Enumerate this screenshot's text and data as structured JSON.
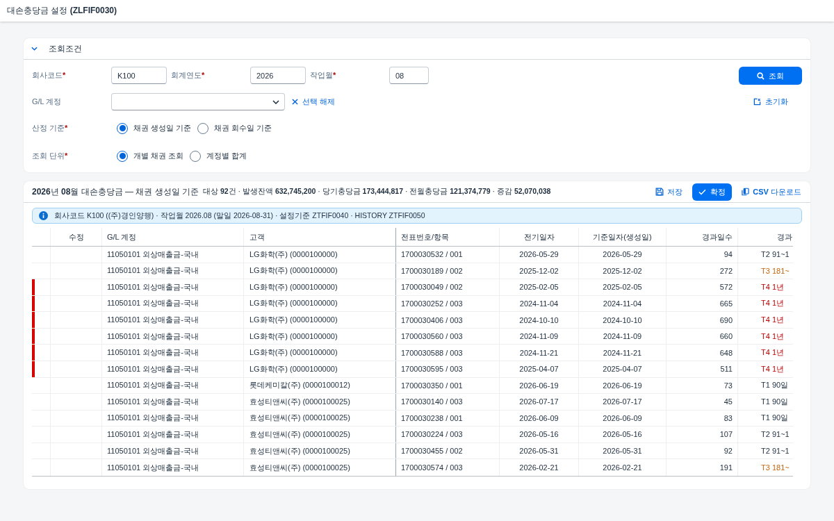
{
  "header": {
    "title": "대손충당금 설정 **(ZLFIF0030)**"
  },
  "filter_panel": {
    "title": "조회조건",
    "expanded": true,
    "fields": [
      {
        "label": "회사코드",
        "required_mark": "*",
        "value": "K100"
      },
      {
        "label": "회계연도",
        "required_mark": "*",
        "value": "2026"
      },
      {
        "label": "작업월",
        "required_mark": "*",
        "value": "08"
      }
    ],
    "gl_account": {
      "label": "G/L 계정",
      "clear_label": "선택 해제"
    },
    "radio_groups": [
      {
        "label": "산정 기준",
        "required_mark": "*",
        "options": [
          {
            "label": "채권 생성일 기준",
            "selected": true
          },
          {
            "label": "채권 회수일 기준",
            "selected": false
          }
        ]
      },
      {
        "label": "조회 단위",
        "required_mark": "*",
        "options": [
          {
            "label": "개별 채권 조회",
            "selected": true
          },
          {
            "label": "계정별 합계",
            "selected": false
          }
        ]
      }
    ],
    "search_button": "조회",
    "reset_link": "초기화"
  },
  "results": {
    "title": "**2026**년 **08**월 대손충당금 — 채권 생성일 기준",
    "summary": "대상 **92**건 · 발생잔액 **632,745,200** · 당기충당금 **173,444,817** · 전월충당금 **121,374,779** · 증감 **52,070,038**",
    "actions": [
      {
        "kind": "link",
        "label": "저장"
      },
      {
        "kind": "primary",
        "label": "확정"
      },
      {
        "kind": "link",
        "label": "**CSV** 다운로드"
      }
    ],
    "info": "회사코드 K100 ((주)경인양행) · 작업월 2026.08 (말일 2026-08-31) · 설정기준 ZTFIF0040 · HISTORY ZTFIF0050",
    "table": {
      "columns": [
        "수정",
        "G/L 계정",
        "고객",
        "전표번호/항목",
        "전기일자",
        "기준일자(생성일)",
        "경과일수",
        "경과"
      ],
      "rows": [
        {
          "flagged": false,
          "gl_account": "11050101 외상매출금-국내",
          "customer": "LG화학(주) (0000100000)",
          "document": "1700030532 / 001",
          "posting_date": "2026-05-29",
          "base_date": "2026-05-29",
          "elapsed_days": "94",
          "aging_bucket": "T2 91~1"
        },
        {
          "flagged": false,
          "gl_account": "11050101 외상매출금-국내",
          "customer": "LG화학(주) (0000100000)",
          "document": "1700030189 / 002",
          "posting_date": "2025-12-02",
          "base_date": "2025-12-02",
          "elapsed_days": "272",
          "aging_bucket": "T3 181~",
          "color": "#c5650c"
        },
        {
          "flagged": true,
          "gl_account": "11050101 외상매출금-국내",
          "customer": "LG화학(주) (0000100000)",
          "document": "1700030049 / 002",
          "posting_date": "2025-02-05",
          "base_date": "2025-02-05",
          "elapsed_days": "572",
          "aging_bucket": "T4 1년",
          "color": "#bb0000"
        },
        {
          "flagged": true,
          "gl_account": "11050101 외상매출금-국내",
          "customer": "LG화학(주) (0000100000)",
          "document": "1700030252 / 003",
          "posting_date": "2024-11-04",
          "base_date": "2024-11-04",
          "elapsed_days": "665",
          "aging_bucket": "T4 1년",
          "color": "#bb0000"
        },
        {
          "flagged": true,
          "gl_account": "11050101 외상매출금-국내",
          "customer": "LG화학(주) (0000100000)",
          "document": "1700030406 / 003",
          "posting_date": "2024-10-10",
          "base_date": "2024-10-10",
          "elapsed_days": "690",
          "aging_bucket": "T4 1년",
          "color": "#bb0000"
        },
        {
          "flagged": true,
          "gl_account": "11050101 외상매출금-국내",
          "customer": "LG화학(주) (0000100000)",
          "document": "1700030560 / 003",
          "posting_date": "2024-11-09",
          "base_date": "2024-11-09",
          "elapsed_days": "660",
          "aging_bucket": "T4 1년",
          "color": "#bb0000"
        },
        {
          "flagged": true,
          "gl_account": "11050101 외상매출금-국내",
          "customer": "LG화학(주) (0000100000)",
          "document": "1700030588 / 003",
          "posting_date": "2024-11-21",
          "base_date": "2024-11-21",
          "elapsed_days": "648",
          "aging_bucket": "T4 1년",
          "color": "#bb0000"
        },
        {
          "flagged": true,
          "gl_account": "11050101 외상매출금-국내",
          "customer": "LG화학(주) (0000100000)",
          "document": "1700030595 / 003",
          "posting_date": "2025-04-07",
          "base_date": "2025-04-07",
          "elapsed_days": "511",
          "aging_bucket": "T4 1년",
          "color": "#bb0000"
        },
        {
          "flagged": false,
          "gl_account": "11050101 외상매출금-국내",
          "customer": "롯데케미칼(주) (0000100012)",
          "document": "1700030350 / 001",
          "posting_date": "2026-06-19",
          "base_date": "2026-06-19",
          "elapsed_days": "73",
          "aging_bucket": "T1 90일"
        },
        {
          "flagged": false,
          "gl_account": "11050101 외상매출금-국내",
          "customer": "효성티앤씨(주) (0000100025)",
          "document": "1700030140 / 003",
          "posting_date": "2026-07-17",
          "base_date": "2026-07-17",
          "elapsed_days": "45",
          "aging_bucket": "T1 90일"
        },
        {
          "flagged": false,
          "gl_account": "11050101 외상매출금-국내",
          "customer": "효성티앤씨(주) (0000100025)",
          "document": "1700030238 / 001",
          "posting_date": "2026-06-09",
          "base_date": "2026-06-09",
          "elapsed_days": "83",
          "aging_bucket": "T1 90일"
        },
        {
          "flagged": false,
          "gl_account": "11050101 외상매출금-국내",
          "customer": "효성티앤씨(주) (0000100025)",
          "document": "1700030224 / 003",
          "posting_date": "2026-05-16",
          "base_date": "2026-05-16",
          "elapsed_days": "107",
          "aging_bucket": "T2 91~1"
        },
        {
          "flagged": false,
          "gl_account": "11050101 외상매출금-국내",
          "customer": "효성티앤씨(주) (0000100025)",
          "document": "1700030455 / 002",
          "posting_date": "2026-05-31",
          "base_date": "2026-05-31",
          "elapsed_days": "92",
          "aging_bucket": "T2 91~1"
        },
        {
          "flagged": false,
          "gl_account": "11050101 외상매출금-국내",
          "customer": "효성티앤씨(주) (0000100025)",
          "document": "1700030574 / 003",
          "posting_date": "2026-02-21",
          "base_date": "2026-02-21",
          "elapsed_days": "191",
          "aging_bucket": "T3 181~",
          "color": "#c5650c"
        }
      ]
    }
  }
}
